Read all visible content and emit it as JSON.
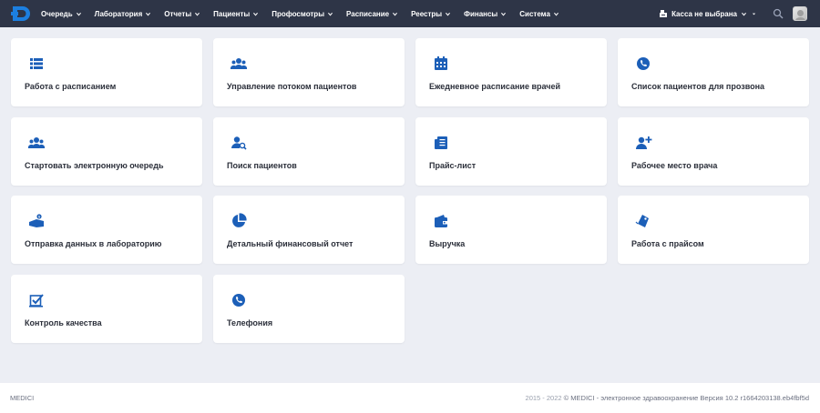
{
  "colors": {
    "topbar": "#2e3547",
    "accent": "#1c6ad6",
    "background": "#eceef4"
  },
  "nav": {
    "items": [
      {
        "label": "Очередь"
      },
      {
        "label": "Лаборатория"
      },
      {
        "label": "Отчеты"
      },
      {
        "label": "Пациенты"
      },
      {
        "label": "Профосмотры"
      },
      {
        "label": "Расписание"
      },
      {
        "label": "Реестры"
      },
      {
        "label": "Финансы"
      },
      {
        "label": "Система"
      }
    ]
  },
  "header": {
    "kassa_label": "Касса не выбрана"
  },
  "cards": [
    {
      "label": "Работа с расписанием",
      "icon": "schedule-list-icon"
    },
    {
      "label": "Управление потоком пациентов",
      "icon": "users-group-icon"
    },
    {
      "label": "Ежедневное расписание врачей",
      "icon": "calendar-icon"
    },
    {
      "label": "Список пациентов для прозвона",
      "icon": "phone-icon"
    },
    {
      "label": "Стартовать электронную очередь",
      "icon": "users-group-icon"
    },
    {
      "label": "Поиск пациентов",
      "icon": "user-search-icon"
    },
    {
      "label": "Прайс-лист",
      "icon": "price-list-icon"
    },
    {
      "label": "Рабочее место врача",
      "icon": "user-plus-icon"
    },
    {
      "label": "Отправка данных в лабораторию",
      "icon": "send-money-icon"
    },
    {
      "label": "Детальный финансовый отчет",
      "icon": "pie-chart-icon"
    },
    {
      "label": "Выручка",
      "icon": "wallet-icon"
    },
    {
      "label": "Работа с прайсом",
      "icon": "tags-icon"
    },
    {
      "label": "Контроль качества",
      "icon": "quality-check-icon"
    },
    {
      "label": "Телефония",
      "icon": "phone-icon"
    }
  ],
  "footer": {
    "left": "MEDICI",
    "years": "2015 - 2022",
    "right": "© MEDICI - электронное здравоохранение Версия 10.2 r1664203138.eb4fbf5d"
  }
}
